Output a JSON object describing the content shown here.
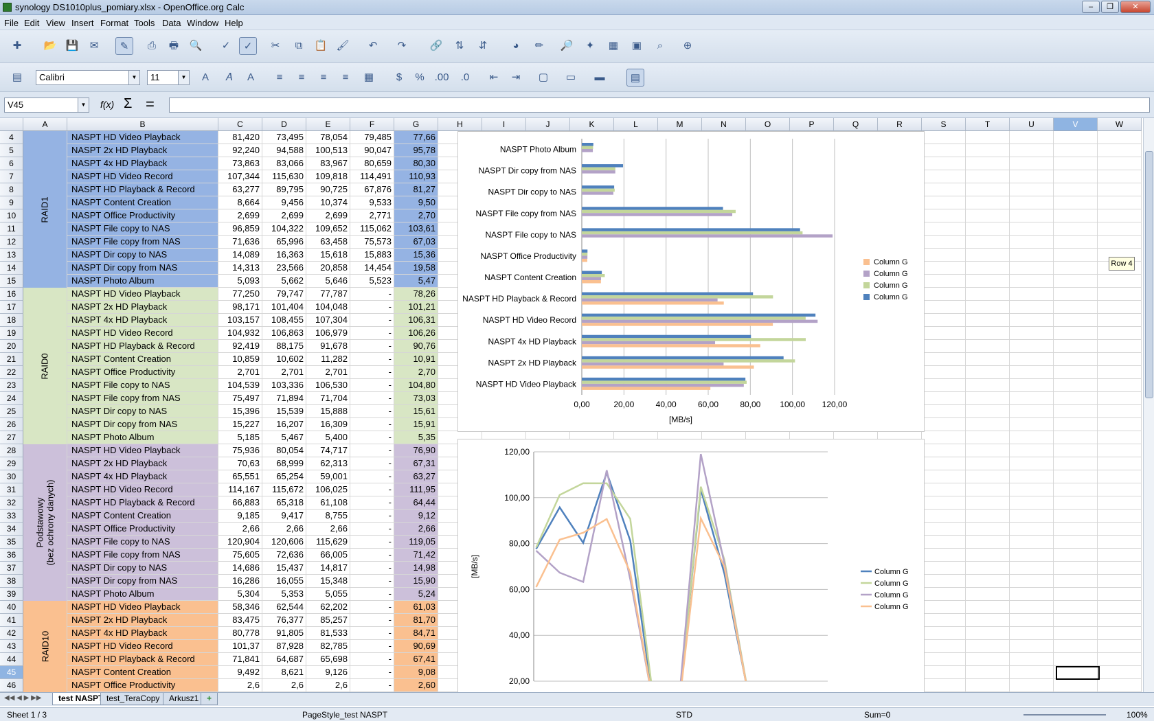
{
  "window": {
    "title": "synology DS1010plus_pomiary.xlsx - OpenOffice.org Calc"
  },
  "menu": [
    "File",
    "Edit",
    "View",
    "Insert",
    "Format",
    "Tools",
    "Data",
    "Window",
    "Help"
  ],
  "toolbar": {
    "font_name": "Calibri",
    "font_size": "11"
  },
  "formula_bar": {
    "cell_ref": "V45",
    "fx": "f(x)",
    "sum": "Σ",
    "equals": "=",
    "content": ""
  },
  "columns": [
    "A",
    "B",
    "C",
    "D",
    "E",
    "F",
    "G",
    "H",
    "I",
    "J",
    "K",
    "L",
    "M",
    "N",
    "O",
    "P",
    "Q",
    "R",
    "S",
    "T",
    "U",
    "V",
    "W"
  ],
  "selected_column": "V",
  "selected_row": "45",
  "groups": [
    {
      "label": "RAID1",
      "color": "#95b3e3",
      "gcolor": "#95b3e3",
      "rows": 12
    },
    {
      "label": "RAID0",
      "color": "#d8e6c4",
      "gcolor": "#d8e6c4",
      "rows": 12
    },
    {
      "label": "Podstawowy\n(bez ochrony danych)",
      "color": "#ccc0da",
      "gcolor": "#ccc0da",
      "rows": 12
    },
    {
      "label": "RAID10",
      "color": "#fac090",
      "gcolor": "#fac090",
      "rows": 7
    }
  ],
  "rows": [
    [
      "4",
      "NASPT HD Video Playback",
      "81,420",
      "73,495",
      "78,054",
      "79,485",
      "77,66"
    ],
    [
      "5",
      "NASPT 2x HD Playback",
      "92,240",
      "94,588",
      "100,513",
      "90,047",
      "95,78"
    ],
    [
      "6",
      "NASPT 4x HD Playback",
      "73,863",
      "83,066",
      "83,967",
      "80,659",
      "80,30"
    ],
    [
      "7",
      "NASPT HD Video Record",
      "107,344",
      "115,630",
      "109,818",
      "114,491",
      "110,93"
    ],
    [
      "8",
      "NASPT HD Playback & Record",
      "63,277",
      "89,795",
      "90,725",
      "67,876",
      "81,27"
    ],
    [
      "9",
      "NASPT Content Creation",
      "8,664",
      "9,456",
      "10,374",
      "9,533",
      "9,50"
    ],
    [
      "10",
      "NASPT Office Productivity",
      "2,699",
      "2,699",
      "2,699",
      "2,771",
      "2,70"
    ],
    [
      "11",
      "NASPT File copy to NAS",
      "96,859",
      "104,322",
      "109,652",
      "115,062",
      "103,61"
    ],
    [
      "12",
      "NASPT File copy from NAS",
      "71,636",
      "65,996",
      "63,458",
      "75,573",
      "67,03"
    ],
    [
      "13",
      "NASPT Dir copy to NAS",
      "14,089",
      "16,363",
      "15,618",
      "15,883",
      "15,36"
    ],
    [
      "14",
      "NASPT Dir copy from NAS",
      "14,313",
      "23,566",
      "20,858",
      "14,454",
      "19,58"
    ],
    [
      "15",
      "NASPT Photo Album",
      "5,093",
      "5,662",
      "5,646",
      "5,523",
      "5,47"
    ],
    [
      "16",
      "NASPT HD Video Playback",
      "77,250",
      "79,747",
      "77,787",
      "-",
      "78,26"
    ],
    [
      "17",
      "NASPT 2x HD Playback",
      "98,171",
      "101,404",
      "104,048",
      "-",
      "101,21"
    ],
    [
      "18",
      "NASPT 4x HD Playback",
      "103,157",
      "108,455",
      "107,304",
      "-",
      "106,31"
    ],
    [
      "19",
      "NASPT HD Video Record",
      "104,932",
      "106,863",
      "106,979",
      "-",
      "106,26"
    ],
    [
      "20",
      "NASPT HD Playback & Record",
      "92,419",
      "88,175",
      "91,678",
      "-",
      "90,76"
    ],
    [
      "21",
      "NASPT Content Creation",
      "10,859",
      "10,602",
      "11,282",
      "-",
      "10,91"
    ],
    [
      "22",
      "NASPT Office Productivity",
      "2,701",
      "2,701",
      "2,701",
      "-",
      "2,70"
    ],
    [
      "23",
      "NASPT File copy to NAS",
      "104,539",
      "103,336",
      "106,530",
      "-",
      "104,80"
    ],
    [
      "24",
      "NASPT File copy from NAS",
      "75,497",
      "71,894",
      "71,704",
      "-",
      "73,03"
    ],
    [
      "25",
      "NASPT Dir copy to NAS",
      "15,396",
      "15,539",
      "15,888",
      "-",
      "15,61"
    ],
    [
      "26",
      "NASPT Dir copy from NAS",
      "15,227",
      "16,207",
      "16,309",
      "-",
      "15,91"
    ],
    [
      "27",
      "NASPT Photo Album",
      "5,185",
      "5,467",
      "5,400",
      "-",
      "5,35"
    ],
    [
      "28",
      "NASPT HD Video Playback",
      "75,936",
      "80,054",
      "74,717",
      "-",
      "76,90"
    ],
    [
      "29",
      "NASPT 2x HD Playback",
      "70,63",
      "68,999",
      "62,313",
      "-",
      "67,31"
    ],
    [
      "30",
      "NASPT 4x HD Playback",
      "65,551",
      "65,254",
      "59,001",
      "-",
      "63,27"
    ],
    [
      "31",
      "NASPT HD Video Record",
      "114,167",
      "115,672",
      "106,025",
      "-",
      "111,95"
    ],
    [
      "32",
      "NASPT HD Playback & Record",
      "66,883",
      "65,318",
      "61,108",
      "-",
      "64,44"
    ],
    [
      "33",
      "NASPT Content Creation",
      "9,185",
      "9,417",
      "8,755",
      "-",
      "9,12"
    ],
    [
      "34",
      "NASPT Office Productivity",
      "2,66",
      "2,66",
      "2,66",
      "-",
      "2,66"
    ],
    [
      "35",
      "NASPT File copy to NAS",
      "120,904",
      "120,606",
      "115,629",
      "-",
      "119,05"
    ],
    [
      "36",
      "NASPT File copy from NAS",
      "75,605",
      "72,636",
      "66,005",
      "-",
      "71,42"
    ],
    [
      "37",
      "NASPT Dir copy to NAS",
      "14,686",
      "15,437",
      "14,817",
      "-",
      "14,98"
    ],
    [
      "38",
      "NASPT Dir copy from NAS",
      "16,286",
      "16,055",
      "15,348",
      "-",
      "15,90"
    ],
    [
      "39",
      "NASPT Photo Album",
      "5,304",
      "5,353",
      "5,055",
      "-",
      "5,24"
    ],
    [
      "40",
      "NASPT HD Video Playback",
      "58,346",
      "62,544",
      "62,202",
      "-",
      "61,03"
    ],
    [
      "41",
      "NASPT 2x HD Playback",
      "83,475",
      "76,377",
      "85,257",
      "-",
      "81,70"
    ],
    [
      "42",
      "NASPT 4x HD Playback",
      "80,778",
      "91,805",
      "81,533",
      "-",
      "84,71"
    ],
    [
      "43",
      "NASPT HD Video Record",
      "101,37",
      "87,928",
      "82,785",
      "-",
      "90,69"
    ],
    [
      "44",
      "NASPT HD Playback & Record",
      "71,841",
      "64,687",
      "65,698",
      "-",
      "67,41"
    ],
    [
      "45",
      "NASPT Content Creation",
      "9,492",
      "8,621",
      "9,126",
      "-",
      "9,08"
    ],
    [
      "46",
      "NASPT Office Productivity",
      "2,6",
      "2,6",
      "2,6",
      "-",
      "2,60"
    ]
  ],
  "chart_data": [
    {
      "type": "bar",
      "orientation": "horizontal",
      "categories": [
        "NASPT HD Video Playback",
        "NASPT 2x HD Playback",
        "NASPT 4x HD Playback",
        "NASPT HD Video Record",
        "NASPT HD Playback & Record",
        "NASPT Content Creation",
        "NASPT Office Productivity",
        "NASPT File copy to NAS",
        "NASPT File copy from NAS",
        "NASPT Dir copy to NAS",
        "NASPT Dir copy from NAS",
        "NASPT Photo Album"
      ],
      "series": [
        {
          "name": "Column G",
          "color": "#4f81bd",
          "values": [
            77.66,
            95.78,
            80.3,
            110.93,
            81.27,
            9.5,
            2.7,
            103.61,
            67.03,
            15.36,
            19.58,
            5.47
          ]
        },
        {
          "name": "Column G",
          "color": "#c3d69b",
          "values": [
            78.26,
            101.21,
            106.31,
            106.26,
            90.76,
            10.91,
            2.7,
            104.8,
            73.03,
            15.61,
            15.91,
            5.35
          ]
        },
        {
          "name": "Column G",
          "color": "#b3a2c7",
          "values": [
            76.9,
            67.31,
            63.27,
            111.95,
            64.44,
            9.12,
            2.66,
            119.05,
            71.42,
            14.98,
            15.9,
            5.24
          ]
        },
        {
          "name": "Column G",
          "color": "#fac090",
          "values": [
            61.03,
            81.7,
            84.71,
            90.69,
            67.41,
            9.08,
            2.6,
            null,
            null,
            null,
            null,
            null
          ]
        }
      ],
      "xlabel": "[MB/s]",
      "xlim": [
        0,
        120
      ],
      "xticks": [
        "0,00",
        "20,00",
        "40,00",
        "60,00",
        "80,00",
        "100,00",
        "120,00"
      ],
      "legend": "right"
    },
    {
      "type": "line",
      "ylabel": "[MB/s]",
      "ylim": [
        20,
        120
      ],
      "yticks": [
        "20,00",
        "40,00",
        "60,00",
        "80,00",
        "100,00",
        "120,00"
      ],
      "series": [
        {
          "name": "Column G",
          "color": "#4f81bd",
          "values": [
            77.66,
            95.78,
            80.3,
            110.93,
            81.27,
            9.5,
            2.7,
            103.61,
            67.03,
            15.36,
            19.58,
            5.47
          ]
        },
        {
          "name": "Column G",
          "color": "#c3d69b",
          "values": [
            78.26,
            101.21,
            106.31,
            106.26,
            90.76,
            10.91,
            2.7,
            104.8,
            73.03,
            15.61,
            15.91,
            5.35
          ]
        },
        {
          "name": "Column G",
          "color": "#b3a2c7",
          "values": [
            76.9,
            67.31,
            63.27,
            111.95,
            64.44,
            9.12,
            2.66,
            119.05,
            71.42,
            14.98,
            15.9,
            5.24
          ]
        },
        {
          "name": "Column G",
          "color": "#fac090",
          "values": [
            61.03,
            81.7,
            84.71,
            90.69,
            67.41,
            9.08,
            2.6,
            91.0,
            70.0,
            15.0,
            15.0,
            5.0
          ]
        }
      ],
      "legend": "right"
    }
  ],
  "tooltip": "Row 4",
  "sheet_tabs": [
    "test NASPT",
    "test_TeraCopy",
    "Arkusz1"
  ],
  "active_tab": "test NASPT",
  "status": {
    "sheet": "Sheet 1 / 3",
    "page_style": "PageStyle_test NASPT",
    "mode": "STD",
    "sum": "Sum=0",
    "zoom": "100%"
  }
}
